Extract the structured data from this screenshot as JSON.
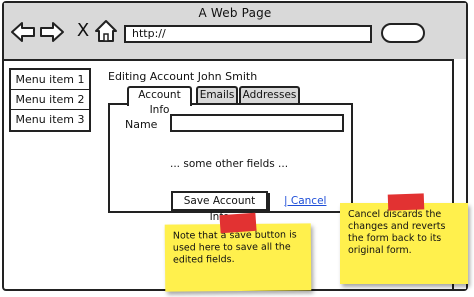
{
  "window": {
    "title": "A Web Page",
    "address": "http://",
    "close_glyph": "X"
  },
  "icons": {
    "back": "left-arrow-icon",
    "forward": "right-arrow-icon",
    "close": "close-icon",
    "home": "home-icon"
  },
  "sidebar": {
    "items": [
      {
        "label": "Menu item 1"
      },
      {
        "label": "Menu item 2"
      },
      {
        "label": "Menu item 3"
      }
    ]
  },
  "main": {
    "heading": "Editing Account John Smith",
    "tabs": [
      {
        "label": "Account Info",
        "active": true
      },
      {
        "label": "Emails",
        "active": false
      },
      {
        "label": "Addresses",
        "active": false
      }
    ],
    "name_label": "Name",
    "name_value": "",
    "other_fields": "... some other fields ...",
    "save_label": "Save Account Info",
    "cancel_label": "| Cancel"
  },
  "notes": {
    "save_note": "Note that a save button is used here to save all the edited fields.",
    "cancel_note": "Cancel discards the changes and reverts the form back to its original form."
  },
  "colors": {
    "note": "#fff04d",
    "tape": "#e23232",
    "link": "#1d4ed8",
    "chrome": "#d9d9d9"
  }
}
